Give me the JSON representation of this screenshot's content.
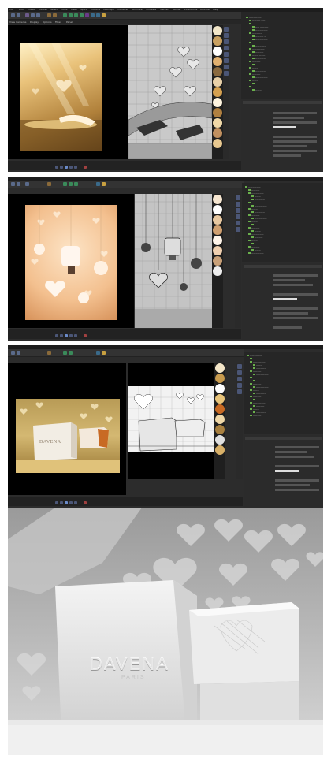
{
  "panels": [
    {
      "id": "panel-1",
      "menu": [
        "File",
        "Edit",
        "Create",
        "Modes",
        "Select",
        "Tools",
        "Mesh",
        "Spline",
        "Volume",
        "MoGraph",
        "Character",
        "Animate",
        "Simulate",
        "Tracker",
        "Render",
        "Extensions",
        "Window",
        "Help"
      ],
      "tabs": [
        "View Cameras",
        "Display",
        "Options",
        "Filter",
        "Panel"
      ],
      "render_state": "warm golden render"
    },
    {
      "id": "panel-2",
      "render_state": "peach render with hanging ornaments"
    },
    {
      "id": "panel-3",
      "render_state": "golden box render"
    }
  ],
  "brand": {
    "name": "DAVENA",
    "sub": "PARIS"
  },
  "colors": {
    "ui_dark": "#2c2c2c",
    "ui_panel": "#262626",
    "accent_blue": "#4b5676",
    "gold": "#c89b4e",
    "peach": "#f4c9a0",
    "grey_render": "#b5b5b5"
  }
}
